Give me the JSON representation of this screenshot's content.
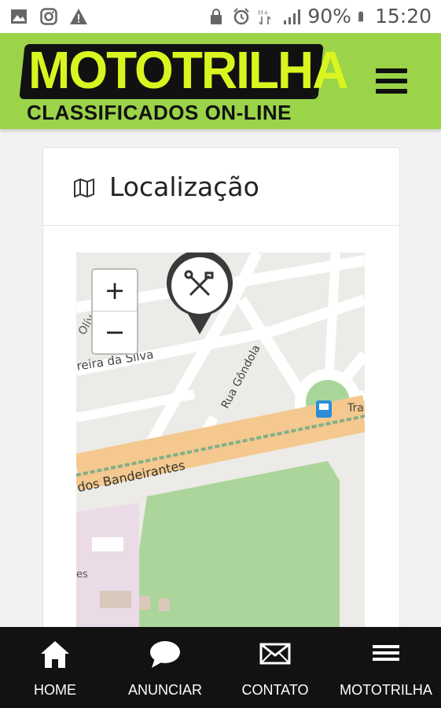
{
  "status_bar": {
    "left_icons": [
      "image-icon",
      "instagram-icon",
      "warning-icon"
    ],
    "right_icons": [
      "lock-icon",
      "alarm-icon",
      "network-icon",
      "signal-icon",
      "battery-icon"
    ],
    "battery_percent": "90%",
    "time": "15:20"
  },
  "header": {
    "logo_text": "MOTOTRILHA",
    "logo_subtitle": "CLASSIFICADOS ON-LINE",
    "menu_icon": "hamburger-icon",
    "brand_color": "#9bd448"
  },
  "card": {
    "title": "Localização",
    "title_icon": "map-icon"
  },
  "map": {
    "zoom_in_label": "+",
    "zoom_out_label": "−",
    "marker_icon": "tools-icon",
    "labels": {
      "street_1": "reira da Silva",
      "street_2": "Rua Gôndola",
      "avenue": "dos Bandeirantes",
      "partial_1": "Olív",
      "partial_2": "Tra",
      "partial_3": "es"
    }
  },
  "bottom_nav": {
    "items": [
      {
        "label": "HOME",
        "icon": "home-icon"
      },
      {
        "label": "ANUNCIAR",
        "icon": "chat-icon"
      },
      {
        "label": "CONTATO",
        "icon": "mail-icon"
      },
      {
        "label": "MOTOTRILHA",
        "icon": "menu-icon"
      }
    ]
  }
}
